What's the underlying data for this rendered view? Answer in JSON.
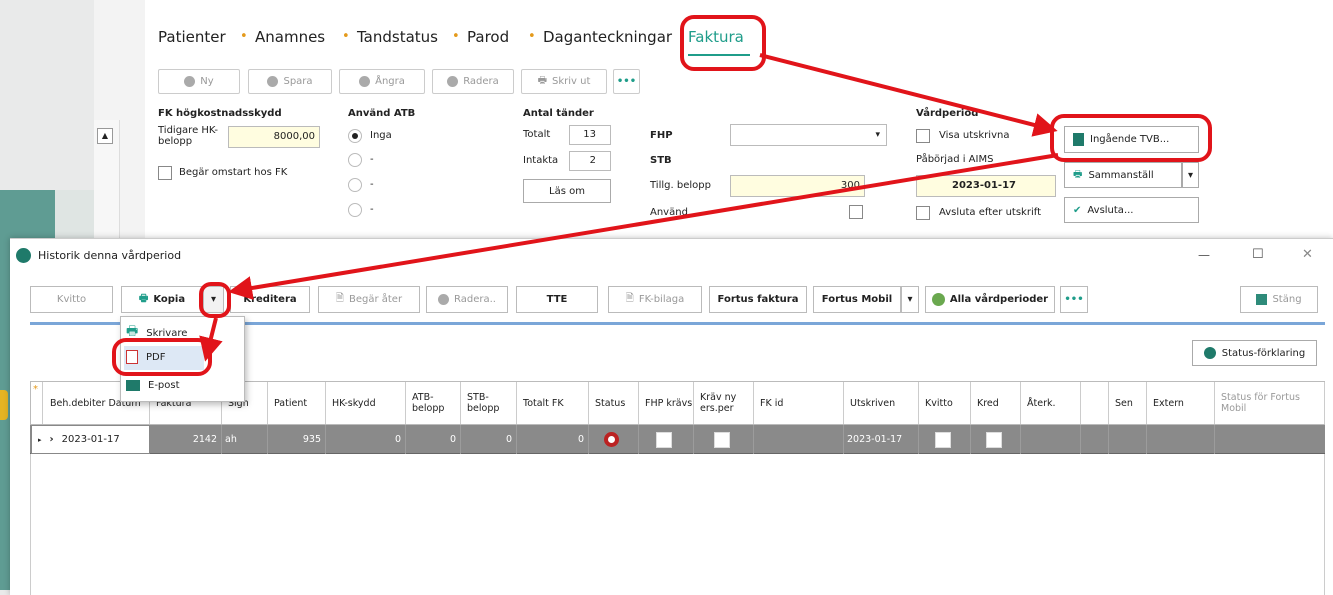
{
  "main": {
    "tabs": [
      "Patienter",
      "Anamnes",
      "Tandstatus",
      "Parod",
      "Daganteckningar",
      "Faktura"
    ],
    "toolbar": [
      "Ny",
      "Spara",
      "Ångra",
      "Radera",
      "Skriv ut",
      "•••"
    ],
    "fk": {
      "heading": "FK högkostnadsskydd",
      "prev_label": "Tidigare HK-belopp",
      "prev_value": "8000,00",
      "restart_label": "Begär omstart hos FK"
    },
    "atb": {
      "heading": "Använd ATB",
      "options": [
        "Inga",
        "-",
        "-",
        "-"
      ]
    },
    "teeth": {
      "heading": "Antal tänder",
      "total_label": "Totalt",
      "total_value": "13",
      "intact_label": "Intakta",
      "intact_value": "2",
      "read_button": "Läs om"
    },
    "fhp": {
      "fhp_label": "FHP",
      "stb_label": "STB",
      "tillig_label": "Tillg. belopp",
      "tillig_value": "300",
      "anvand_label": "Använd"
    },
    "period": {
      "heading": "Vårdperiod",
      "show_label": "Visa utskrivna",
      "started_label": "Påbörjad i AIMS",
      "date": "2023-01-17",
      "end_label": "Avsluta efter utskrift",
      "ingaende_button": "Ingående TVB...",
      "sammanstall_button": "Sammanställ",
      "avsluta_button": "Avsluta..."
    }
  },
  "history": {
    "title": "Historik denna vårdperiod",
    "window_controls": [
      "—",
      "☐",
      "✕"
    ],
    "toolbar": {
      "kvitto": "Kvitto",
      "kopia": "Kopia",
      "kreditera": "Kreditera",
      "begar_ater": "Begär åter",
      "radera": "Radera..",
      "tte": "TTE",
      "fk_bilaga": "FK-bilaga",
      "fortus_faktura": "Fortus faktura",
      "fortus_mobil": "Fortus Mobil",
      "alla": "Alla vårdperioder",
      "more": "•••",
      "stang": "Stäng"
    },
    "status_button": "Status-förklaring",
    "menu": [
      "Skrivare",
      "PDF",
      "E-post"
    ],
    "columns": [
      "Beh.debiter Datum",
      "Faktura",
      "Sign",
      "Patient",
      "HK-skydd",
      "ATB-belopp",
      "STB-belopp",
      "Totalt FK",
      "Status",
      "FHP krävs",
      "Kräv ny ers.per",
      "FK id",
      "Utskriven",
      "Kvitto",
      "Kred",
      "Återk.",
      "",
      "Sen",
      "Extern",
      "Status för Fortus Mobil"
    ],
    "row": {
      "date": "2023-01-17",
      "faktura": "2142",
      "sign": "ah",
      "patient": "935",
      "hk": "0",
      "atb": "0",
      "stb": "0",
      "totalt": "0",
      "utskriven": "2023-01-17"
    }
  },
  "colors": {
    "accent": "#1f9d8a",
    "annotation": "#e1141a",
    "bullet": "#e49a1c"
  }
}
